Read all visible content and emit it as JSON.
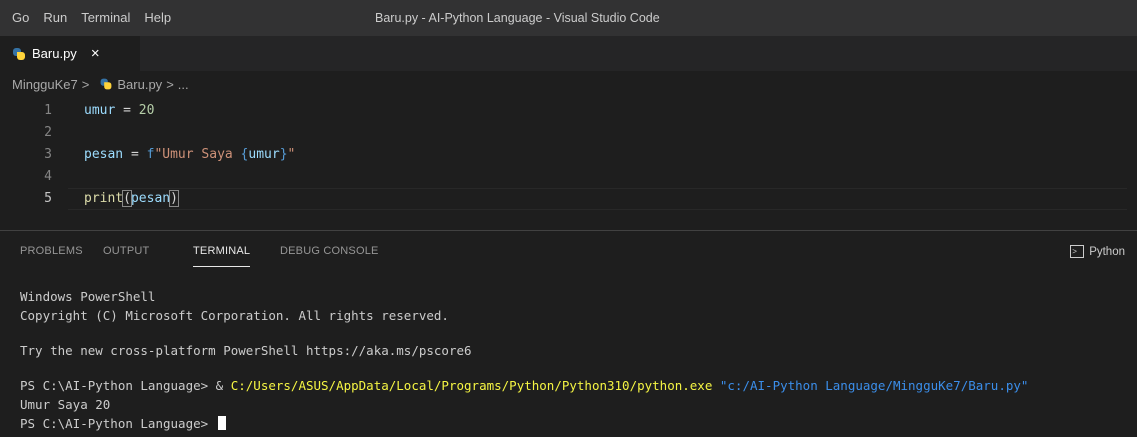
{
  "menu": [
    "Go",
    "Run",
    "Terminal",
    "Help"
  ],
  "window_title": "Baru.py - AI-Python Language - Visual Studio Code",
  "tab": {
    "label": "Baru.py",
    "close_glyph": "×",
    "icon": "python-file-icon"
  },
  "breadcrumb": {
    "folder": "MingguKe7",
    "file": "Baru.py",
    "trail": "...",
    "sep": ">"
  },
  "editor": {
    "lines": [
      {
        "num": "1"
      },
      {
        "num": "2"
      },
      {
        "num": "3"
      },
      {
        "num": "4"
      },
      {
        "num": "5"
      }
    ],
    "tokens": {
      "l1_var": "umur",
      "l1_eq": " = ",
      "l1_num": "20",
      "l3_var": "pesan",
      "l3_eq": " = ",
      "l3_f": "f",
      "l3_str1": "\"Umur Saya ",
      "l3_brace_open": "{",
      "l3_inner": "umur",
      "l3_brace_close": "}",
      "l3_str2": "\"",
      "l5_fn": "print",
      "l5_open": "(",
      "l5_arg": "pesan",
      "l5_close": ")"
    }
  },
  "panel": {
    "tabs": [
      "PROBLEMS",
      "OUTPUT",
      "TERMINAL",
      "DEBUG CONSOLE"
    ],
    "active_tab": "TERMINAL",
    "shell_label": "Python",
    "shell_icon": "terminal-icon"
  },
  "terminal": {
    "l1": "Windows PowerShell",
    "l2": "Copyright (C) Microsoft Corporation. All rights reserved.",
    "l3": "Try the new cross-platform PowerShell https://aka.ms/pscore6",
    "cmd_prompt": "PS C:\\AI-Python Language> & ",
    "cmd_exe": "C:/Users/ASUS/AppData/Local/Programs/Python/Python310/python.exe",
    "cmd_arg": " \"c:/AI-Python Language/MingguKe7/Baru.py\"",
    "output": "Umur Saya 20",
    "prompt": "PS C:\\AI-Python Language> "
  },
  "colors": {
    "background": "#1e1e1e",
    "keyword": "#569cd6",
    "string": "#ce9178",
    "exe_path": "#f5f543",
    "arg_path": "#3b8eea"
  }
}
